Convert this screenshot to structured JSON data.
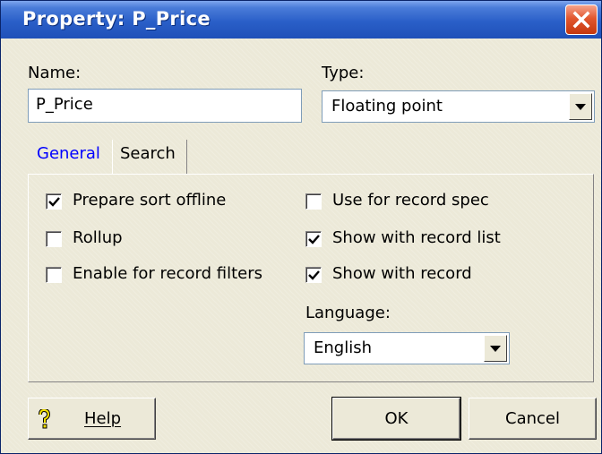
{
  "window": {
    "title": "Property:  P_Price"
  },
  "name_field": {
    "label": "Name:",
    "value": "P_Price"
  },
  "type_field": {
    "label": "Type:",
    "value": "Floating point"
  },
  "tabs": [
    {
      "label": "General",
      "active": true
    },
    {
      "label": "Search",
      "active": false
    }
  ],
  "general": {
    "left_checkboxes": [
      {
        "label": "Prepare sort offline",
        "checked": true
      },
      {
        "label": "Rollup",
        "checked": false
      },
      {
        "label": "Enable for record filters",
        "checked": false
      }
    ],
    "right_checkboxes": [
      {
        "label": "Use for record spec",
        "checked": false
      },
      {
        "label": "Show with record list",
        "checked": true
      },
      {
        "label": "Show with record",
        "checked": true
      }
    ],
    "language": {
      "label": "Language:",
      "value": "English"
    }
  },
  "buttons": {
    "help": "Help",
    "ok": "OK",
    "cancel": "Cancel"
  },
  "colors": {
    "titlebar": "#2a5fc8",
    "close": "#e2572f",
    "active_tab": "#0000ff",
    "face": "#ece9d8"
  },
  "icons": {
    "close": "close-icon",
    "help": "help-icon",
    "dropdown": "chevron-down-icon",
    "check": "check-icon"
  }
}
